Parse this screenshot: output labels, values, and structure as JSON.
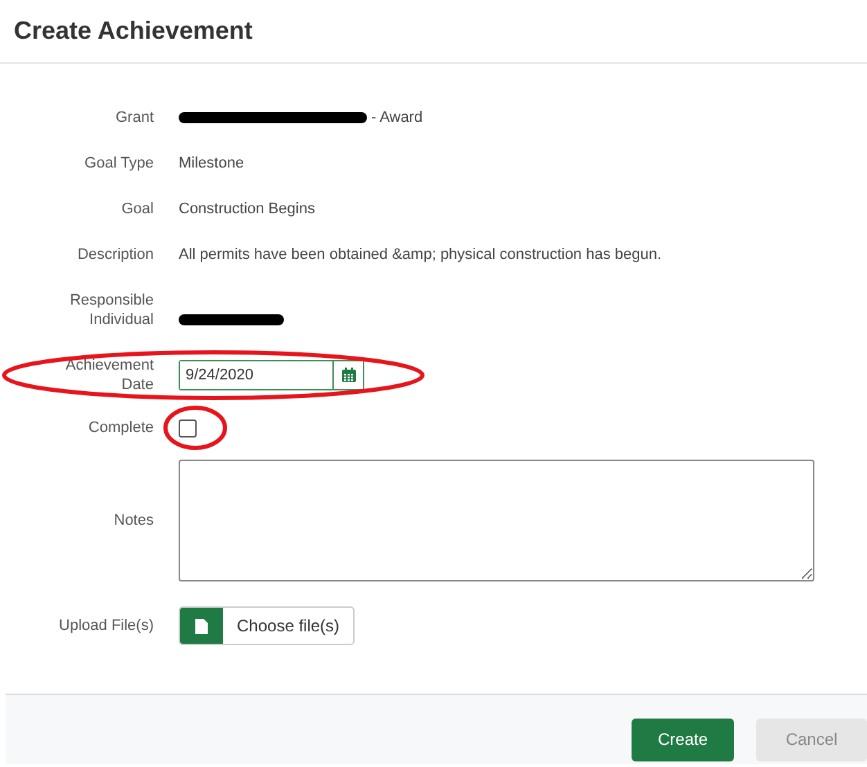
{
  "title": "Create Achievement",
  "fields": [
    {
      "kind": "redacted-text",
      "label": "Grant",
      "value": "- Award"
    },
    {
      "kind": "text",
      "label": "Goal Type",
      "value": "Milestone"
    },
    {
      "kind": "text",
      "label": "Goal",
      "value": "Construction Begins"
    },
    {
      "kind": "text",
      "label": "Description",
      "value": "All permits have been obtained &amp; physical construction has begun."
    },
    {
      "kind": "redacted",
      "label": "Responsible Individual"
    },
    {
      "kind": "date",
      "label": "Achievement Date",
      "value": "9/24/2020",
      "circled": true
    },
    {
      "kind": "checkbox",
      "label": "Complete",
      "checked": false,
      "circled": true
    },
    {
      "kind": "textarea",
      "label": "Notes"
    },
    {
      "kind": "file",
      "label": "Upload File(s)",
      "button": "Choose file(s)"
    }
  ],
  "buttons": [
    {
      "label": "Create",
      "primary": true
    },
    {
      "label": "Cancel",
      "primary": false
    }
  ]
}
